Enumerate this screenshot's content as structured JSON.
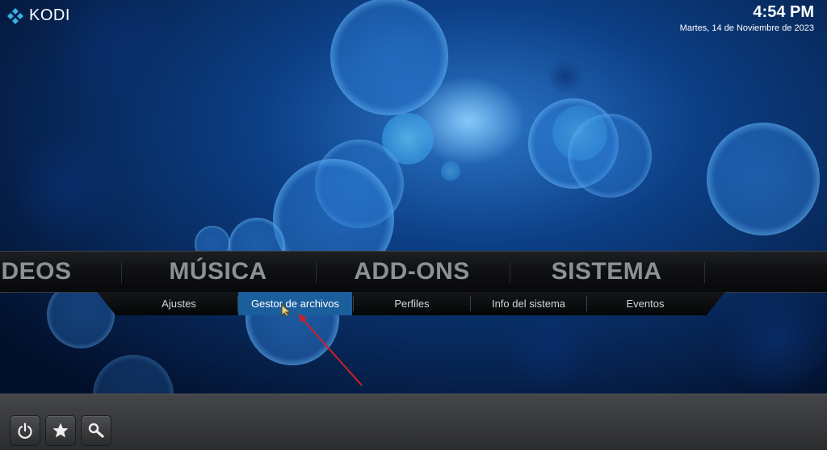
{
  "app": {
    "name": "KODI"
  },
  "clock": {
    "time": "4:54 PM",
    "date": "Martes, 14 de Noviembre de 2023"
  },
  "main_menu": {
    "items": [
      "DEOS",
      "MÚSICA",
      "ADD-ONS",
      "SISTEMA"
    ]
  },
  "submenu": {
    "items": [
      "Ajustes",
      "Gestor de archivos",
      "Perfiles",
      "Info del sistema",
      "Eventos"
    ],
    "selected": "Gestor de archivos"
  },
  "bottom_buttons": {
    "icons": [
      "power-icon",
      "star-icon",
      "search-icon"
    ]
  },
  "colors": {
    "accent": "#1a5e9c",
    "background": "#021a3f",
    "annotation_arrow": "#d0202a"
  }
}
